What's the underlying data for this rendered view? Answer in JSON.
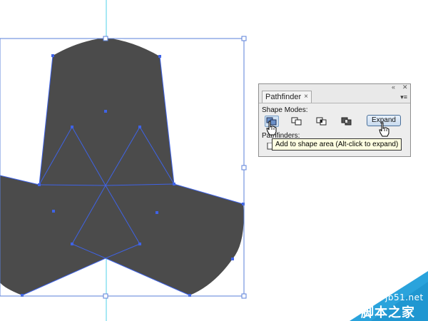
{
  "panel": {
    "tab_label": "Pathfinder",
    "tab_close": "×",
    "window_collapse": "«",
    "window_close": "✕",
    "menu_icon": "▾≡",
    "shape_modes_label": "Shape Modes:",
    "pathfinders_label": "Pathfinders:",
    "expand_label": "Expand",
    "shape_mode_buttons": [
      "add-to-shape-area",
      "subtract-from-shape-area",
      "intersect-shape-areas",
      "exclude-overlapping-shape-areas"
    ],
    "active_mode": "add-to-shape-area"
  },
  "tooltip": {
    "text": "Add to shape area (Alt-click to expand)"
  },
  "watermark": {
    "site": "jb51.net",
    "name": "脚本之家"
  },
  "colors": {
    "shape_fill": "#4b4b4b",
    "path_stroke": "#3f63e6",
    "guide": "#4fd2ea",
    "watermark_blue": "#2aa3dc"
  }
}
